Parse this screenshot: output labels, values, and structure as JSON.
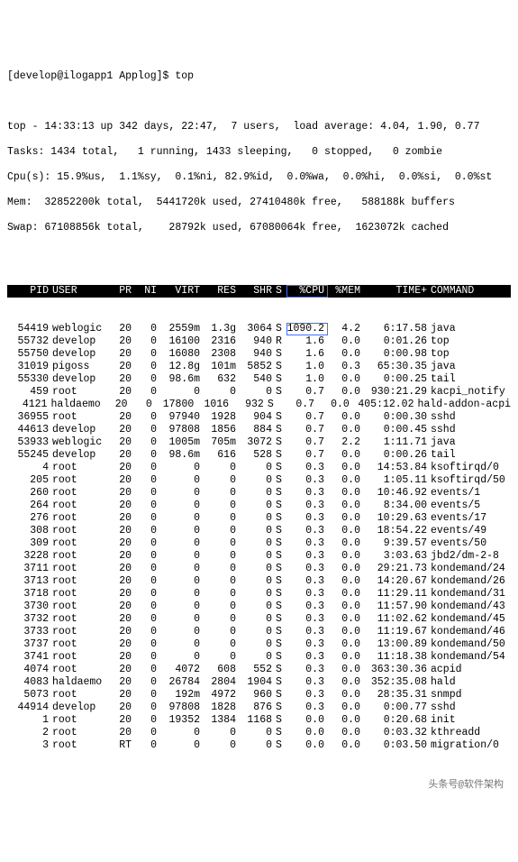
{
  "prompt": "[develop@ilogapp1 Applog]$ top",
  "summary": {
    "l1": "top - 14:33:13 up 342 days, 22:47,  7 users,  load average: 4.04, 1.90, 0.77",
    "l2": "Tasks: 1434 total,   1 running, 1433 sleeping,   0 stopped,   0 zombie",
    "l3": "Cpu(s): 15.9%us,  1.1%sy,  0.1%ni, 82.9%id,  0.0%wa,  0.0%hi,  0.0%si,  0.0%st",
    "l4": "Mem:  32852200k total,  5441720k used, 27410480k free,   588188k buffers",
    "l5": "Swap: 67108856k total,    28792k used, 67080064k free,  1623072k cached"
  },
  "columns": {
    "pid": "PID",
    "user": "USER",
    "pr": "PR",
    "ni": "NI",
    "virt": "VIRT",
    "res": "RES",
    "shr": "SHR",
    "s": "S",
    "cpu": "%CPU",
    "mem": "%MEM",
    "time": "TIME+",
    "cmd": "COMMAND"
  },
  "processes": [
    {
      "pid": "54419",
      "user": "weblogic",
      "pr": "20",
      "ni": "0",
      "virt": "2559m",
      "res": "1.3g",
      "shr": "3064",
      "s": "S",
      "cpu": "1090.2",
      "mem": "4.2",
      "time": "6:17.58",
      "cmd": "java",
      "hl": true
    },
    {
      "pid": "55732",
      "user": "develop",
      "pr": "20",
      "ni": "0",
      "virt": "16100",
      "res": "2316",
      "shr": "940",
      "s": "R",
      "cpu": "1.6",
      "mem": "0.0",
      "time": "0:01.26",
      "cmd": "top"
    },
    {
      "pid": "55750",
      "user": "develop",
      "pr": "20",
      "ni": "0",
      "virt": "16080",
      "res": "2308",
      "shr": "940",
      "s": "S",
      "cpu": "1.6",
      "mem": "0.0",
      "time": "0:00.98",
      "cmd": "top"
    },
    {
      "pid": "31019",
      "user": "pigoss",
      "pr": "20",
      "ni": "0",
      "virt": "12.8g",
      "res": "101m",
      "shr": "5852",
      "s": "S",
      "cpu": "1.0",
      "mem": "0.3",
      "time": "65:30.35",
      "cmd": "java"
    },
    {
      "pid": "55330",
      "user": "develop",
      "pr": "20",
      "ni": "0",
      "virt": "98.6m",
      "res": "632",
      "shr": "540",
      "s": "S",
      "cpu": "1.0",
      "mem": "0.0",
      "time": "0:00.25",
      "cmd": "tail"
    },
    {
      "pid": "459",
      "user": "root",
      "pr": "20",
      "ni": "0",
      "virt": "0",
      "res": "0",
      "shr": "0",
      "s": "S",
      "cpu": "0.7",
      "mem": "0.0",
      "time": "930:21.29",
      "cmd": "kacpi_notify"
    },
    {
      "pid": "4121",
      "user": "haldaemo",
      "pr": "20",
      "ni": "0",
      "virt": "17800",
      "res": "1016",
      "shr": "932",
      "s": "S",
      "cpu": "0.7",
      "mem": "0.0",
      "time": "405:12.02",
      "cmd": "hald-addon-acpi"
    },
    {
      "pid": "36955",
      "user": "root",
      "pr": "20",
      "ni": "0",
      "virt": "97940",
      "res": "1928",
      "shr": "904",
      "s": "S",
      "cpu": "0.7",
      "mem": "0.0",
      "time": "0:00.30",
      "cmd": "sshd"
    },
    {
      "pid": "44613",
      "user": "develop",
      "pr": "20",
      "ni": "0",
      "virt": "97808",
      "res": "1856",
      "shr": "884",
      "s": "S",
      "cpu": "0.7",
      "mem": "0.0",
      "time": "0:00.45",
      "cmd": "sshd"
    },
    {
      "pid": "53933",
      "user": "weblogic",
      "pr": "20",
      "ni": "0",
      "virt": "1005m",
      "res": "705m",
      "shr": "3072",
      "s": "S",
      "cpu": "0.7",
      "mem": "2.2",
      "time": "1:11.71",
      "cmd": "java"
    },
    {
      "pid": "55245",
      "user": "develop",
      "pr": "20",
      "ni": "0",
      "virt": "98.6m",
      "res": "616",
      "shr": "528",
      "s": "S",
      "cpu": "0.7",
      "mem": "0.0",
      "time": "0:00.26",
      "cmd": "tail"
    },
    {
      "pid": "4",
      "user": "root",
      "pr": "20",
      "ni": "0",
      "virt": "0",
      "res": "0",
      "shr": "0",
      "s": "S",
      "cpu": "0.3",
      "mem": "0.0",
      "time": "14:53.84",
      "cmd": "ksoftirqd/0"
    },
    {
      "pid": "205",
      "user": "root",
      "pr": "20",
      "ni": "0",
      "virt": "0",
      "res": "0",
      "shr": "0",
      "s": "S",
      "cpu": "0.3",
      "mem": "0.0",
      "time": "1:05.11",
      "cmd": "ksoftirqd/50"
    },
    {
      "pid": "260",
      "user": "root",
      "pr": "20",
      "ni": "0",
      "virt": "0",
      "res": "0",
      "shr": "0",
      "s": "S",
      "cpu": "0.3",
      "mem": "0.0",
      "time": "10:46.92",
      "cmd": "events/1"
    },
    {
      "pid": "264",
      "user": "root",
      "pr": "20",
      "ni": "0",
      "virt": "0",
      "res": "0",
      "shr": "0",
      "s": "S",
      "cpu": "0.3",
      "mem": "0.0",
      "time": "8:34.00",
      "cmd": "events/5"
    },
    {
      "pid": "276",
      "user": "root",
      "pr": "20",
      "ni": "0",
      "virt": "0",
      "res": "0",
      "shr": "0",
      "s": "S",
      "cpu": "0.3",
      "mem": "0.0",
      "time": "10:29.63",
      "cmd": "events/17"
    },
    {
      "pid": "308",
      "user": "root",
      "pr": "20",
      "ni": "0",
      "virt": "0",
      "res": "0",
      "shr": "0",
      "s": "S",
      "cpu": "0.3",
      "mem": "0.0",
      "time": "18:54.22",
      "cmd": "events/49"
    },
    {
      "pid": "309",
      "user": "root",
      "pr": "20",
      "ni": "0",
      "virt": "0",
      "res": "0",
      "shr": "0",
      "s": "S",
      "cpu": "0.3",
      "mem": "0.0",
      "time": "9:39.57",
      "cmd": "events/50"
    },
    {
      "pid": "3228",
      "user": "root",
      "pr": "20",
      "ni": "0",
      "virt": "0",
      "res": "0",
      "shr": "0",
      "s": "S",
      "cpu": "0.3",
      "mem": "0.0",
      "time": "3:03.63",
      "cmd": "jbd2/dm-2-8"
    },
    {
      "pid": "3711",
      "user": "root",
      "pr": "20",
      "ni": "0",
      "virt": "0",
      "res": "0",
      "shr": "0",
      "s": "S",
      "cpu": "0.3",
      "mem": "0.0",
      "time": "29:21.73",
      "cmd": "kondemand/24"
    },
    {
      "pid": "3713",
      "user": "root",
      "pr": "20",
      "ni": "0",
      "virt": "0",
      "res": "0",
      "shr": "0",
      "s": "S",
      "cpu": "0.3",
      "mem": "0.0",
      "time": "14:20.67",
      "cmd": "kondemand/26"
    },
    {
      "pid": "3718",
      "user": "root",
      "pr": "20",
      "ni": "0",
      "virt": "0",
      "res": "0",
      "shr": "0",
      "s": "S",
      "cpu": "0.3",
      "mem": "0.0",
      "time": "11:29.11",
      "cmd": "kondemand/31"
    },
    {
      "pid": "3730",
      "user": "root",
      "pr": "20",
      "ni": "0",
      "virt": "0",
      "res": "0",
      "shr": "0",
      "s": "S",
      "cpu": "0.3",
      "mem": "0.0",
      "time": "11:57.90",
      "cmd": "kondemand/43"
    },
    {
      "pid": "3732",
      "user": "root",
      "pr": "20",
      "ni": "0",
      "virt": "0",
      "res": "0",
      "shr": "0",
      "s": "S",
      "cpu": "0.3",
      "mem": "0.0",
      "time": "11:02.62",
      "cmd": "kondemand/45"
    },
    {
      "pid": "3733",
      "user": "root",
      "pr": "20",
      "ni": "0",
      "virt": "0",
      "res": "0",
      "shr": "0",
      "s": "S",
      "cpu": "0.3",
      "mem": "0.0",
      "time": "11:19.67",
      "cmd": "kondemand/46"
    },
    {
      "pid": "3737",
      "user": "root",
      "pr": "20",
      "ni": "0",
      "virt": "0",
      "res": "0",
      "shr": "0",
      "s": "S",
      "cpu": "0.3",
      "mem": "0.0",
      "time": "13:00.89",
      "cmd": "kondemand/50"
    },
    {
      "pid": "3741",
      "user": "root",
      "pr": "20",
      "ni": "0",
      "virt": "0",
      "res": "0",
      "shr": "0",
      "s": "S",
      "cpu": "0.3",
      "mem": "0.0",
      "time": "11:18.38",
      "cmd": "kondemand/54"
    },
    {
      "pid": "4074",
      "user": "root",
      "pr": "20",
      "ni": "0",
      "virt": "4072",
      "res": "608",
      "shr": "552",
      "s": "S",
      "cpu": "0.3",
      "mem": "0.0",
      "time": "363:30.36",
      "cmd": "acpid"
    },
    {
      "pid": "4083",
      "user": "haldaemo",
      "pr": "20",
      "ni": "0",
      "virt": "26784",
      "res": "2804",
      "shr": "1904",
      "s": "S",
      "cpu": "0.3",
      "mem": "0.0",
      "time": "352:35.08",
      "cmd": "hald"
    },
    {
      "pid": "5073",
      "user": "root",
      "pr": "20",
      "ni": "0",
      "virt": "192m",
      "res": "4972",
      "shr": "960",
      "s": "S",
      "cpu": "0.3",
      "mem": "0.0",
      "time": "28:35.31",
      "cmd": "snmpd"
    },
    {
      "pid": "44914",
      "user": "develop",
      "pr": "20",
      "ni": "0",
      "virt": "97808",
      "res": "1828",
      "shr": "876",
      "s": "S",
      "cpu": "0.3",
      "mem": "0.0",
      "time": "0:00.77",
      "cmd": "sshd"
    },
    {
      "pid": "1",
      "user": "root",
      "pr": "20",
      "ni": "0",
      "virt": "19352",
      "res": "1384",
      "shr": "1168",
      "s": "S",
      "cpu": "0.0",
      "mem": "0.0",
      "time": "0:20.68",
      "cmd": "init"
    },
    {
      "pid": "2",
      "user": "root",
      "pr": "20",
      "ni": "0",
      "virt": "0",
      "res": "0",
      "shr": "0",
      "s": "S",
      "cpu": "0.0",
      "mem": "0.0",
      "time": "0:03.32",
      "cmd": "kthreadd"
    },
    {
      "pid": "3",
      "user": "root",
      "pr": "RT",
      "ni": "0",
      "virt": "0",
      "res": "0",
      "shr": "0",
      "s": "S",
      "cpu": "0.0",
      "mem": "0.0",
      "time": "0:03.50",
      "cmd": "migration/0"
    }
  ],
  "watermark": "头条号@软件架构"
}
